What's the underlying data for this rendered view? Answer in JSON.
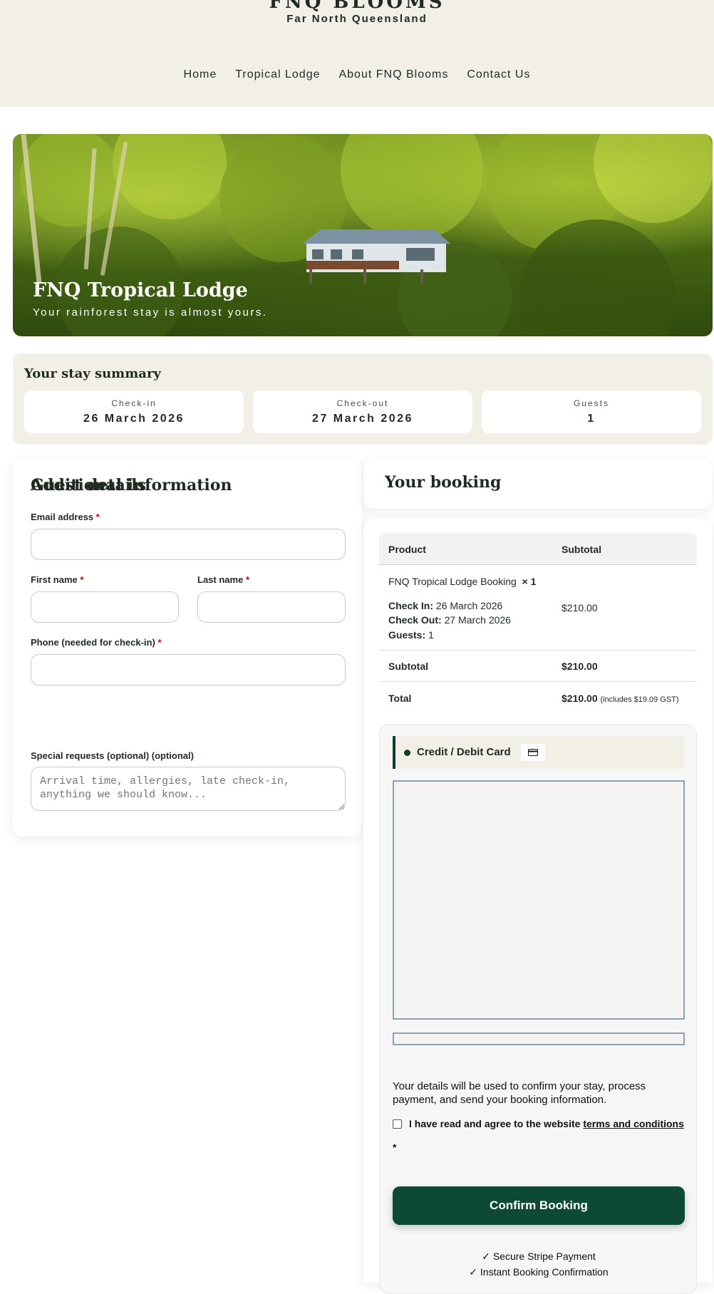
{
  "brand": {
    "title": "FNQ BLOOMS",
    "subtitle": "Far North Queensland"
  },
  "nav": [
    "Home",
    "Tropical Lodge",
    "About FNQ Blooms",
    "Contact Us"
  ],
  "hero": {
    "title": "FNQ Tropical Lodge",
    "subtitle": "Your rainforest stay is almost yours."
  },
  "summary": {
    "title": "Your stay summary",
    "checkin_label": "Check-in",
    "checkin_value": "26 March 2026",
    "checkout_label": "Check-out",
    "checkout_value": "27 March 2026",
    "guests_label": "Guests",
    "guests_value": "1"
  },
  "guest_details": {
    "title": "Guest details",
    "email_label": "Email address",
    "first_name_label": "First name",
    "last_name_label": "Last name",
    "phone_label": "Phone (needed for check-in)",
    "required_mark": "*",
    "email_value": "",
    "first_name_value": "",
    "last_name_value": "",
    "phone_value": ""
  },
  "additional": {
    "title": "Additional information",
    "requests_label": "Special requests (optional) (optional)",
    "requests_placeholder": "Arrival time, allergies, late check-in, anything we should know..."
  },
  "booking": {
    "title": "Your booking",
    "col_product": "Product",
    "col_subtotal": "Subtotal",
    "product_name": "FNQ Tropical Lodge Booking",
    "product_qty": "× 1",
    "checkin_key": "Check In:",
    "checkin_val": "26 March 2026",
    "checkout_key": "Check Out:",
    "checkout_val": "27 March 2026",
    "guests_key": "Guests:",
    "guests_val": "1",
    "line_price": "$210.00",
    "subtotal_label": "Subtotal",
    "subtotal_value": "$210.00",
    "total_label": "Total",
    "total_value": "$210.00",
    "total_note": "(includes $19.09 GST)"
  },
  "payment": {
    "method_label": "Credit / Debit Card",
    "method_icon": "credit-card-icon",
    "privacy_text": "Your details will be used to confirm your stay, process payment, and send your booking information.",
    "terms_prefix": "I have read and agree to the website",
    "terms_link": "terms and conditions",
    "terms_required": "*",
    "confirm_label": "Confirm Booking",
    "assurances": [
      "✓ Secure Stripe Payment",
      "✓ Instant Booking Confirmation"
    ]
  },
  "colors": {
    "brand_green": "#0c4a35",
    "header_bg": "#f1efe6",
    "required_red": "#cc0000"
  }
}
